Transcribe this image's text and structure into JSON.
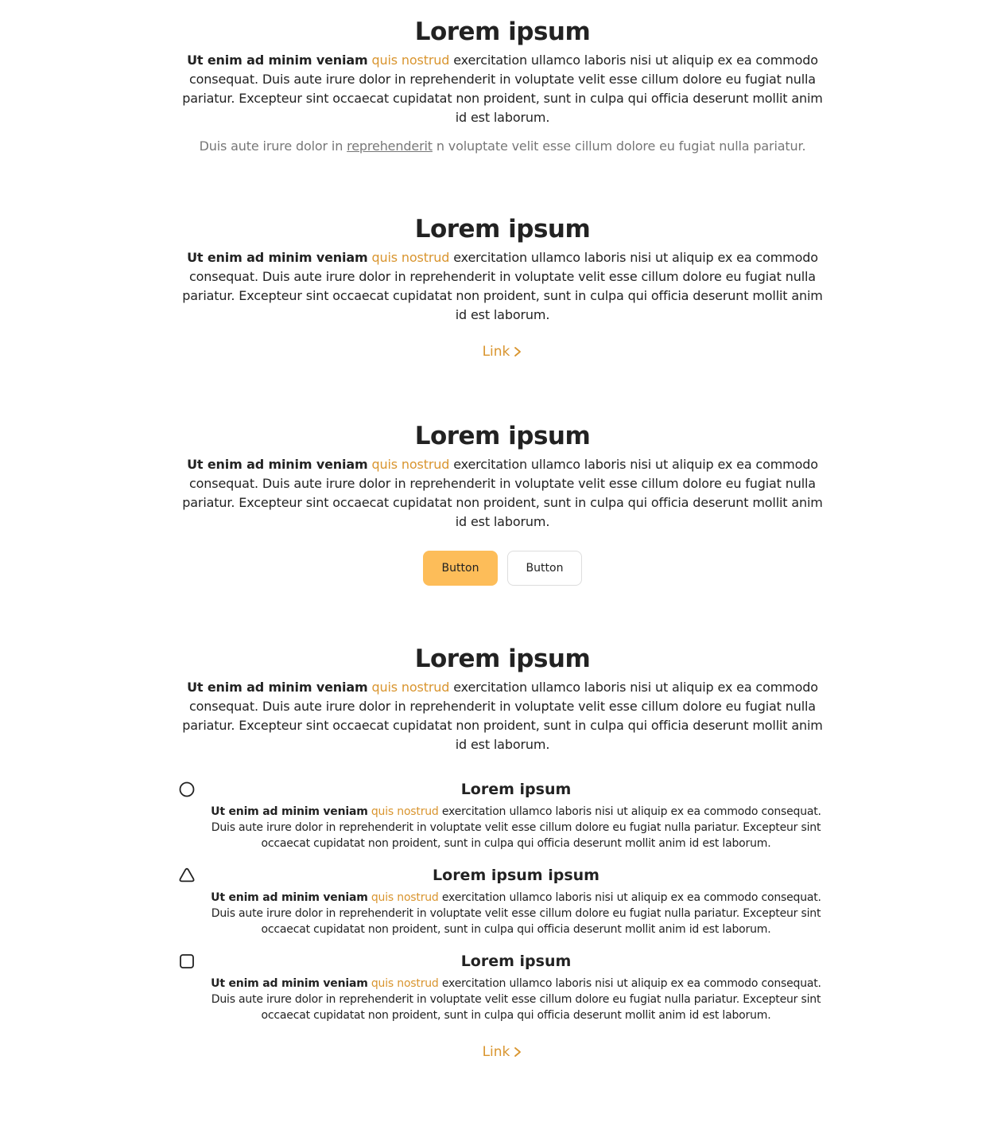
{
  "colors": {
    "accent": "#d9952f",
    "primary_button": "#fdbd59",
    "text": "#222222",
    "muted": "#777777"
  },
  "sections": [
    {
      "title": "Lorem ipsum",
      "bold": "Ut enim ad minim veniam",
      "highlight": "quis nostrud",
      "rest": "exercitation ullamco laboris nisi ut aliquip ex ea commodo consequat. Duis aute irure dolor in reprehenderit in voluptate velit esse cillum dolore eu fugiat nulla pariatur. Excepteur sint occaecat cupidatat non proident, sunt in culpa qui officia deserunt mollit anim id est laborum.",
      "note_before": "Duis aute irure dolor in",
      "note_link": "reprehenderit",
      "note_after": "n voluptate velit esse cillum dolore eu fugiat nulla pariatur."
    },
    {
      "title": "Lorem ipsum",
      "bold": "Ut enim ad minim veniam",
      "highlight": "quis nostrud",
      "rest": "exercitation ullamco laboris nisi ut aliquip ex ea commodo consequat. Duis aute irure dolor in reprehenderit in voluptate velit esse cillum dolore eu fugiat nulla pariatur. Excepteur sint occaecat cupidatat non proident, sunt in culpa qui officia deserunt mollit anim id est laborum.",
      "link_label": "Link"
    },
    {
      "title": "Lorem ipsum",
      "bold": "Ut enim ad minim veniam",
      "highlight": "quis nostrud",
      "rest": "exercitation ullamco laboris nisi ut aliquip ex ea commodo consequat. Duis aute irure dolor in reprehenderit in voluptate velit esse cillum dolore eu fugiat nulla pariatur. Excepteur sint occaecat cupidatat non proident, sunt in culpa qui officia deserunt mollit anim id est laborum.",
      "primary_button": "Button",
      "secondary_button": "Button"
    },
    {
      "title": "Lorem ipsum",
      "bold": "Ut enim ad minim veniam",
      "highlight": "quis nostrud",
      "rest": "exercitation ullamco laboris nisi ut aliquip ex ea commodo consequat. Duis aute irure dolor in reprehenderit in voluptate velit esse cillum dolore eu fugiat nulla pariatur. Excepteur sint occaecat cupidatat non proident, sunt in culpa qui officia deserunt mollit anim id est laborum.",
      "features": [
        {
          "icon": "circle-icon",
          "title": "Lorem ipsum",
          "bold": "Ut enim ad minim veniam",
          "highlight": "quis nostrud",
          "rest": "exercitation ullamco laboris nisi ut aliquip ex ea commodo consequat. Duis aute irure dolor in reprehenderit in voluptate velit esse cillum dolore eu fugiat nulla pariatur. Excepteur sint occaecat cupidatat non proident, sunt in culpa qui officia deserunt mollit anim id est laborum."
        },
        {
          "icon": "triangle-icon",
          "title": "Lorem ipsum ipsum",
          "bold": "Ut enim ad minim veniam",
          "highlight": "quis nostrud",
          "rest": "exercitation ullamco laboris nisi ut aliquip ex ea commodo consequat. Duis aute irure dolor in reprehenderit in voluptate velit esse cillum dolore eu fugiat nulla pariatur. Excepteur sint occaecat cupidatat non proident, sunt in culpa qui officia deserunt mollit anim id est laborum."
        },
        {
          "icon": "square-icon",
          "title": "Lorem ipsum",
          "bold": "Ut enim ad minim veniam",
          "highlight": "quis nostrud",
          "rest": "exercitation ullamco laboris nisi ut aliquip ex ea commodo consequat. Duis aute irure dolor in reprehenderit in voluptate velit esse cillum dolore eu fugiat nulla pariatur. Excepteur sint occaecat cupidatat non proident, sunt in culpa qui officia deserunt mollit anim id est laborum."
        }
      ],
      "link_label": "Link"
    }
  ]
}
